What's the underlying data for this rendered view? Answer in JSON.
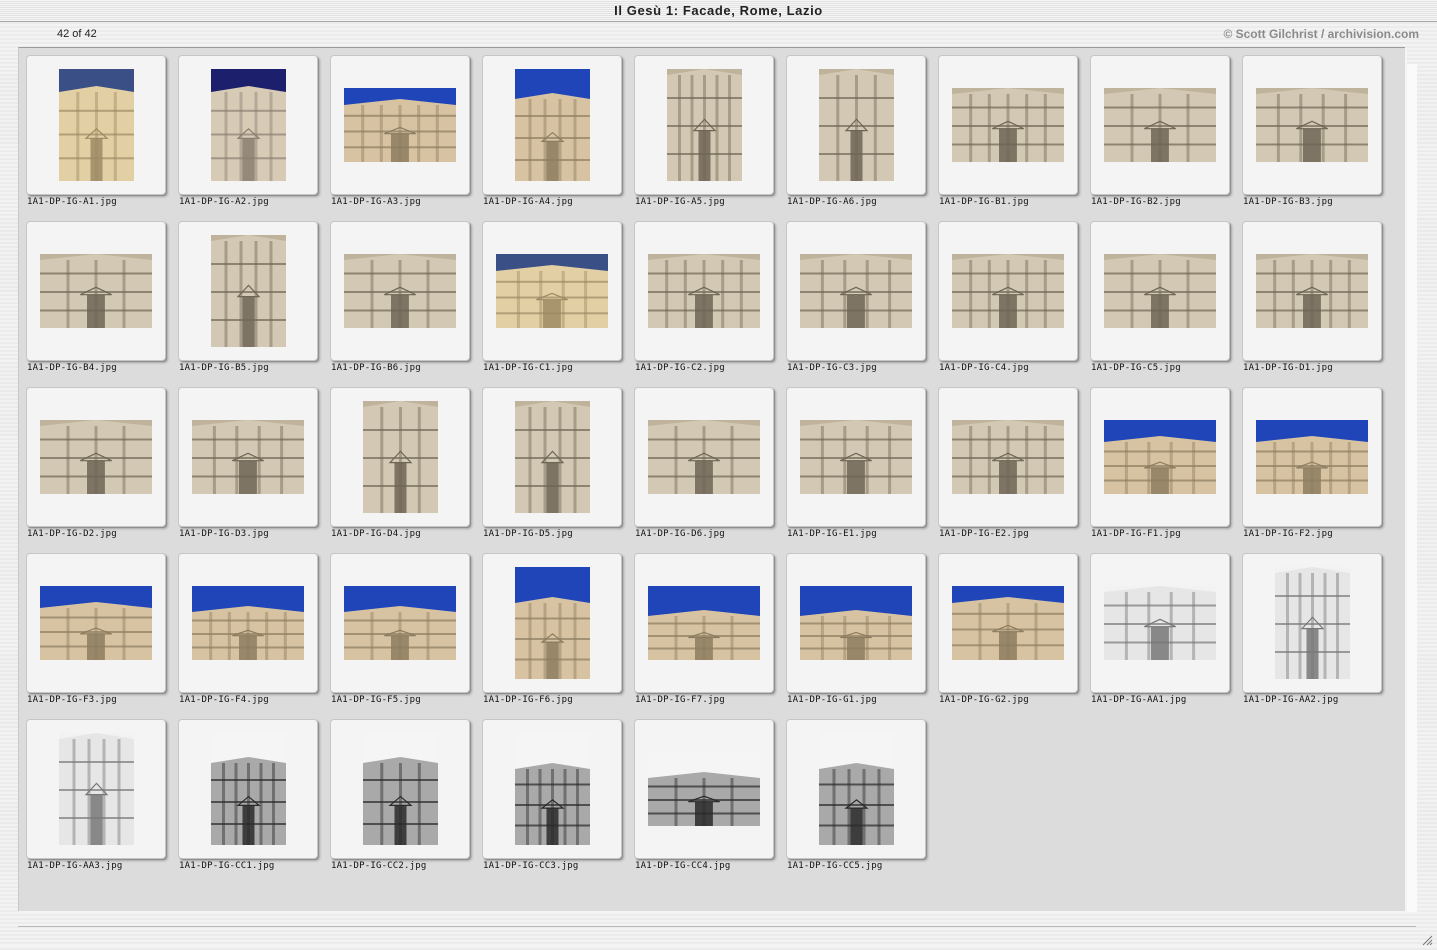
{
  "window": {
    "title": "Il Gesù 1: Facade, Rome, Lazio"
  },
  "header": {
    "count": "42 of 42",
    "credit": "© Scott Gilchrist / archivision.com"
  },
  "items": [
    {
      "file": "1A1-DP-IG-A1.jpg",
      "orient": "portrait",
      "tone": "warm"
    },
    {
      "file": "1A1-DP-IG-A2.jpg",
      "orient": "portrait",
      "tone": "dusk"
    },
    {
      "file": "1A1-DP-IG-A3.jpg",
      "orient": "landscape",
      "tone": "sky"
    },
    {
      "file": "1A1-DP-IG-A4.jpg",
      "orient": "portrait",
      "tone": "sky"
    },
    {
      "file": "1A1-DP-IG-A5.jpg",
      "orient": "portrait",
      "tone": "stone"
    },
    {
      "file": "1A1-DP-IG-A6.jpg",
      "orient": "portrait",
      "tone": "stone"
    },
    {
      "file": "1A1-DP-IG-B1.jpg",
      "orient": "landscape",
      "tone": "stone"
    },
    {
      "file": "1A1-DP-IG-B2.jpg",
      "orient": "landscape",
      "tone": "stone"
    },
    {
      "file": "1A1-DP-IG-B3.jpg",
      "orient": "landscape",
      "tone": "stone"
    },
    {
      "file": "1A1-DP-IG-B4.jpg",
      "orient": "landscape",
      "tone": "stone"
    },
    {
      "file": "1A1-DP-IG-B5.jpg",
      "orient": "portrait",
      "tone": "stone"
    },
    {
      "file": "1A1-DP-IG-B6.jpg",
      "orient": "landscape",
      "tone": "stone"
    },
    {
      "file": "1A1-DP-IG-C1.jpg",
      "orient": "landscape",
      "tone": "warm"
    },
    {
      "file": "1A1-DP-IG-C2.jpg",
      "orient": "landscape",
      "tone": "stone"
    },
    {
      "file": "1A1-DP-IG-C3.jpg",
      "orient": "landscape",
      "tone": "stone"
    },
    {
      "file": "1A1-DP-IG-C4.jpg",
      "orient": "landscape",
      "tone": "stone"
    },
    {
      "file": "1A1-DP-IG-C5.jpg",
      "orient": "landscape",
      "tone": "stone"
    },
    {
      "file": "1A1-DP-IG-D1.jpg",
      "orient": "landscape",
      "tone": "stone"
    },
    {
      "file": "1A1-DP-IG-D2.jpg",
      "orient": "landscape",
      "tone": "stone"
    },
    {
      "file": "1A1-DP-IG-D3.jpg",
      "orient": "landscape",
      "tone": "stone"
    },
    {
      "file": "1A1-DP-IG-D4.jpg",
      "orient": "portrait",
      "tone": "stone"
    },
    {
      "file": "1A1-DP-IG-D5.jpg",
      "orient": "portrait",
      "tone": "stone"
    },
    {
      "file": "1A1-DP-IG-D6.jpg",
      "orient": "landscape",
      "tone": "stone"
    },
    {
      "file": "1A1-DP-IG-E1.jpg",
      "orient": "landscape",
      "tone": "stone"
    },
    {
      "file": "1A1-DP-IG-E2.jpg",
      "orient": "landscape",
      "tone": "stone"
    },
    {
      "file": "1A1-DP-IG-F1.jpg",
      "orient": "landscape",
      "tone": "sky"
    },
    {
      "file": "1A1-DP-IG-F2.jpg",
      "orient": "landscape",
      "tone": "sky"
    },
    {
      "file": "1A1-DP-IG-F3.jpg",
      "orient": "landscape",
      "tone": "sky"
    },
    {
      "file": "1A1-DP-IG-F4.jpg",
      "orient": "landscape",
      "tone": "sky"
    },
    {
      "file": "1A1-DP-IG-F5.jpg",
      "orient": "landscape",
      "tone": "sky"
    },
    {
      "file": "1A1-DP-IG-F6.jpg",
      "orient": "portrait",
      "tone": "sky"
    },
    {
      "file": "1A1-DP-IG-F7.jpg",
      "orient": "landscape",
      "tone": "sky"
    },
    {
      "file": "1A1-DP-IG-G1.jpg",
      "orient": "landscape",
      "tone": "sky"
    },
    {
      "file": "1A1-DP-IG-G2.jpg",
      "orient": "landscape",
      "tone": "sky"
    },
    {
      "file": "1A1-DP-IG-AA1.jpg",
      "orient": "landscape",
      "tone": "drawing"
    },
    {
      "file": "1A1-DP-IG-AA2.jpg",
      "orient": "portrait",
      "tone": "drawing"
    },
    {
      "file": "1A1-DP-IG-AA3.jpg",
      "orient": "portrait",
      "tone": "drawing"
    },
    {
      "file": "1A1-DP-IG-CC1.jpg",
      "orient": "portrait",
      "tone": "bw"
    },
    {
      "file": "1A1-DP-IG-CC2.jpg",
      "orient": "portrait",
      "tone": "bw"
    },
    {
      "file": "1A1-DP-IG-CC3.jpg",
      "orient": "portrait",
      "tone": "bw"
    },
    {
      "file": "1A1-DP-IG-CC4.jpg",
      "orient": "landscape",
      "tone": "bw"
    },
    {
      "file": "1A1-DP-IG-CC5.jpg",
      "orient": "portrait",
      "tone": "bw"
    }
  ],
  "palette": {
    "warm": {
      "bg": "#3a4f86",
      "wall": "#e2cfa3",
      "line": "#9d8a64"
    },
    "dusk": {
      "bg": "#1c1f6b",
      "wall": "#d8cbb6",
      "line": "#8a7e70"
    },
    "sky": {
      "bg": "#1f45b8",
      "wall": "#d7c3a2",
      "line": "#8d7c5f"
    },
    "stone": {
      "bg": "#bfb39c",
      "wall": "#d3c8b3",
      "line": "#6f6555"
    },
    "drawing": {
      "bg": "#f2f2f2",
      "wall": "#e6e6e6",
      "line": "#777777"
    },
    "bw": {
      "bg": "#f5f5f5",
      "wall": "#a9a9a9",
      "line": "#2a2a2a"
    }
  }
}
